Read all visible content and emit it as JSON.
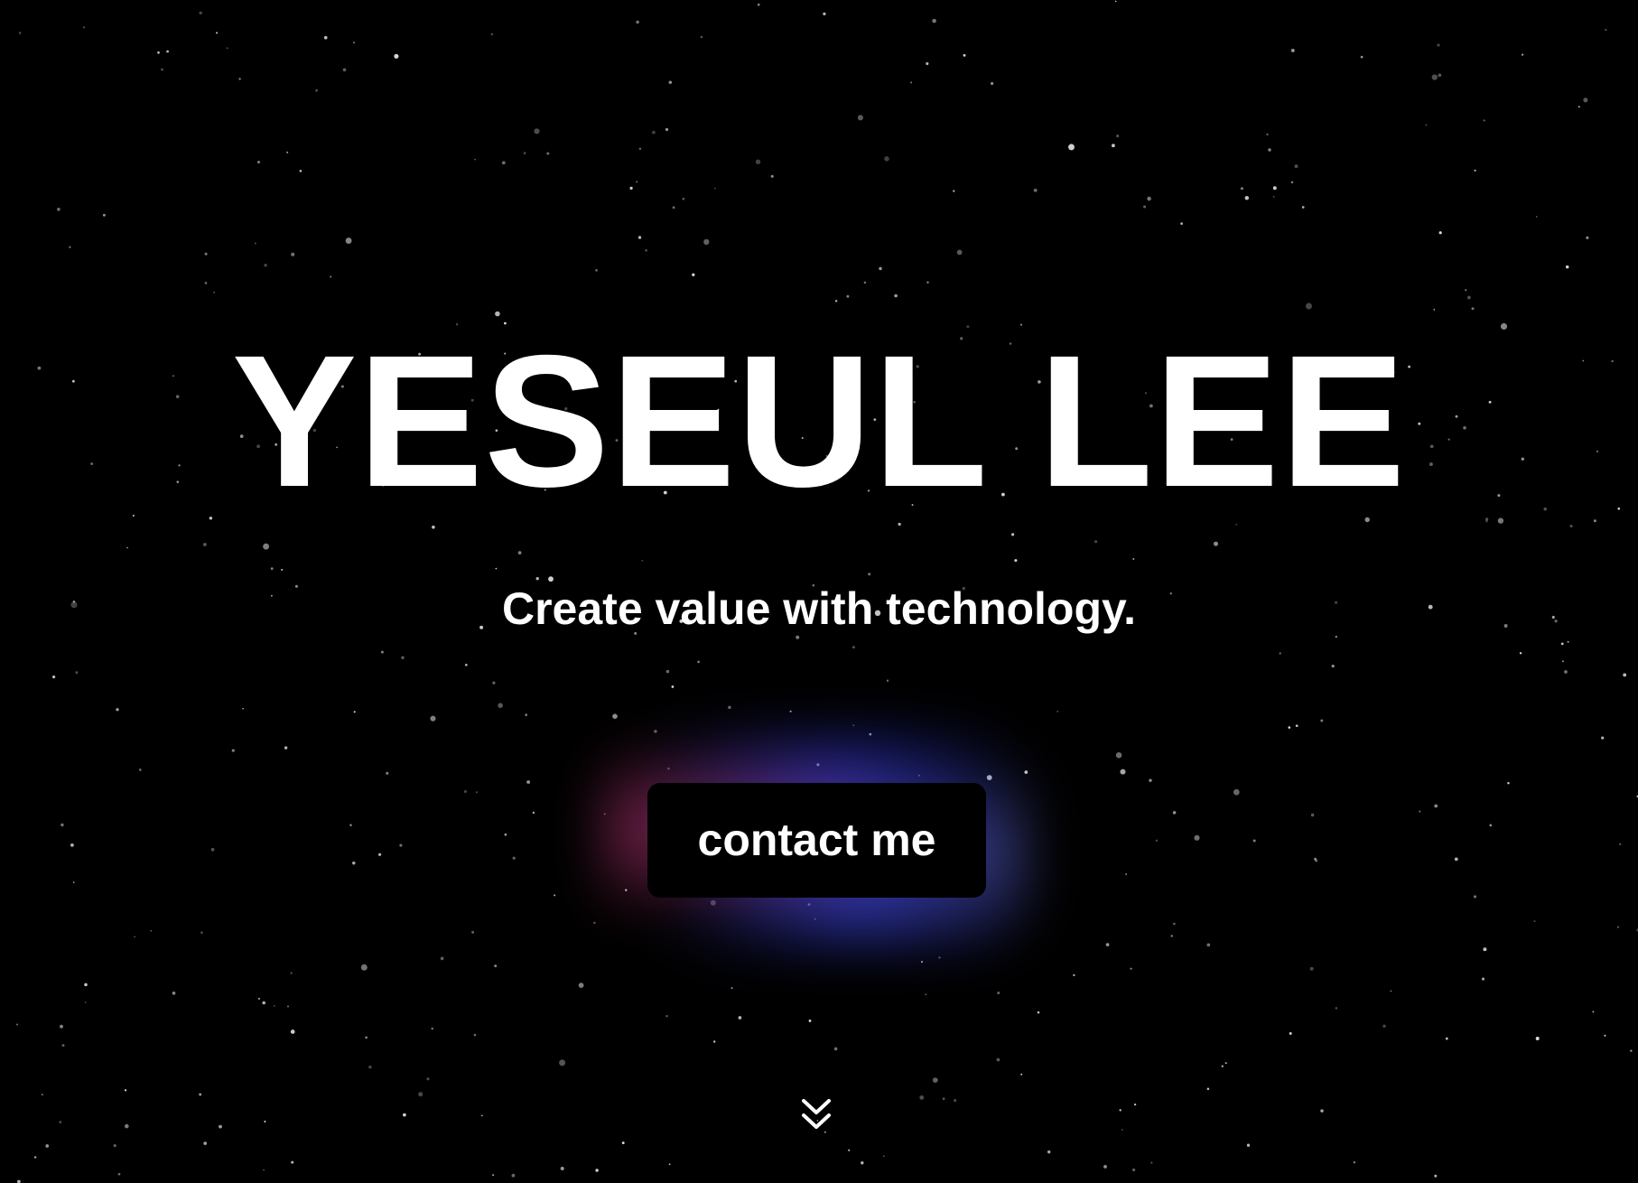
{
  "hero": {
    "title": "YESEUL LEE",
    "subtitle": "Create value with technology.",
    "contact_label": "contact me",
    "scroll_icon": "double-chevron-down-icon"
  },
  "colors": {
    "background": "#000000",
    "text": "#ffffff",
    "glow_pink": "#cd3c82",
    "glow_blue": "#323ce6"
  }
}
